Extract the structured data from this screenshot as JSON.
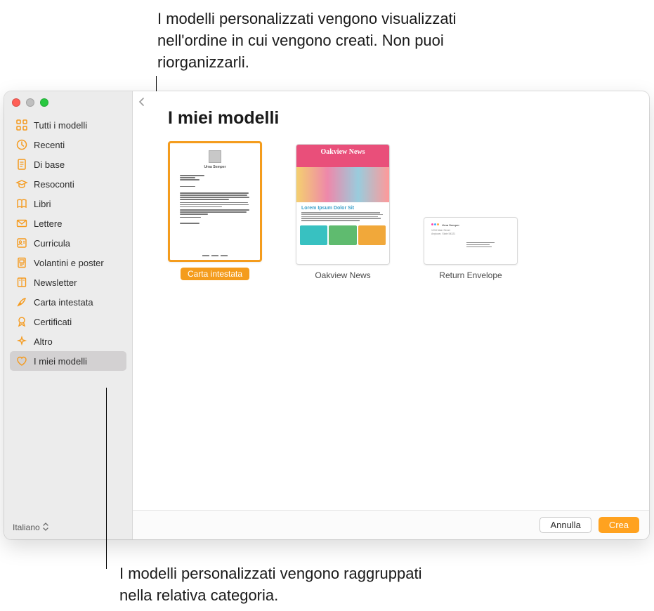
{
  "annotations": {
    "top": "I modelli personalizzati vengono visualizzati nell'ordine in cui vengono creati. Non puoi riorganizzarli.",
    "bottom": "I modelli personalizzati vengono raggruppati nella relativa categoria."
  },
  "sidebar": {
    "items": [
      {
        "label": "Tutti i modelli",
        "icon": "grid"
      },
      {
        "label": "Recenti",
        "icon": "clock"
      },
      {
        "label": "Di base",
        "icon": "doc"
      },
      {
        "label": "Resoconti",
        "icon": "grad"
      },
      {
        "label": "Libri",
        "icon": "book"
      },
      {
        "label": "Lettere",
        "icon": "envelope"
      },
      {
        "label": "Curricula",
        "icon": "person-lines"
      },
      {
        "label": "Volantini e poster",
        "icon": "poster"
      },
      {
        "label": "Newsletter",
        "icon": "columns"
      },
      {
        "label": "Carta intestata",
        "icon": "quill"
      },
      {
        "label": "Certificati",
        "icon": "ribbon"
      },
      {
        "label": "Altro",
        "icon": "sparkle"
      },
      {
        "label": "I miei modelli",
        "icon": "heart",
        "selected": true
      }
    ],
    "language": "Italiano"
  },
  "main": {
    "title": "I miei modelli",
    "templates": [
      {
        "label": "Carta intestata",
        "selected": true,
        "kind": "letterhead"
      },
      {
        "label": "Oakview News",
        "kind": "newsletter",
        "headline": "Oakview News",
        "subhead": "Lorem Ipsum Dolor Sit"
      },
      {
        "label": "Return Envelope",
        "kind": "envelope"
      }
    ]
  },
  "footer": {
    "cancel": "Annulla",
    "create": "Crea"
  }
}
